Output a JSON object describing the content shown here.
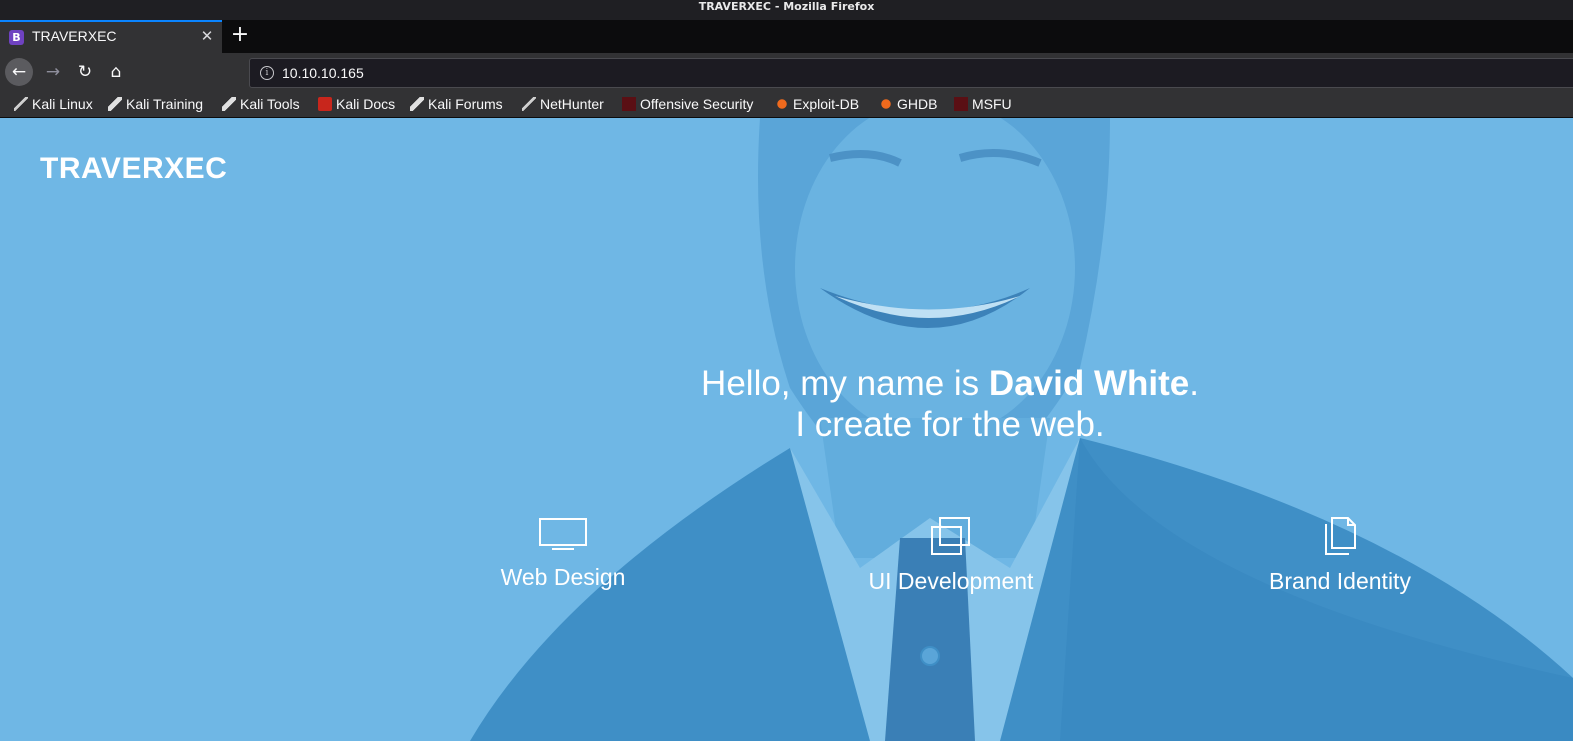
{
  "window": {
    "title": "TRAVERXEC - Mozilla Firefox"
  },
  "tab": {
    "favicon": "B",
    "title": "TRAVERXEC",
    "close": "✕",
    "new_tab": "+"
  },
  "nav": {
    "back": "←",
    "forward": "→",
    "reload": "↻",
    "home": "⌂",
    "url": "10.10.10.165"
  },
  "bookmarks": [
    {
      "label": "Kali Linux",
      "icon": "kali-icon"
    },
    {
      "label": "Kali Training",
      "icon": "kali-tool-icon"
    },
    {
      "label": "Kali Tools",
      "icon": "kali-tool-icon"
    },
    {
      "label": "Kali Docs",
      "icon": "kali-docs-icon"
    },
    {
      "label": "Kali Forums",
      "icon": "kali-tool-icon"
    },
    {
      "label": "NetHunter",
      "icon": "kali-icon"
    },
    {
      "label": "Offensive Security",
      "icon": "offsec-icon"
    },
    {
      "label": "Exploit-DB",
      "icon": "exploit-db-icon"
    },
    {
      "label": "GHDB",
      "icon": "exploit-db-icon"
    },
    {
      "label": "MSFU",
      "icon": "offsec-icon"
    }
  ],
  "page": {
    "brand": "TRAVERXEC",
    "headline_prefix": "Hello, my name is ",
    "headline_name": "David White",
    "headline_suffix": ".",
    "headline_line2": "I create for the web.",
    "services": [
      {
        "label": "Web Design",
        "icon": "monitor-icon"
      },
      {
        "label": "UI Development",
        "icon": "copy-windows-icon"
      },
      {
        "label": "Brand Identity",
        "icon": "documents-icon"
      }
    ],
    "colors": {
      "overlay": "#6fb7e5",
      "dark_overlay": "#3f8fc6"
    }
  }
}
